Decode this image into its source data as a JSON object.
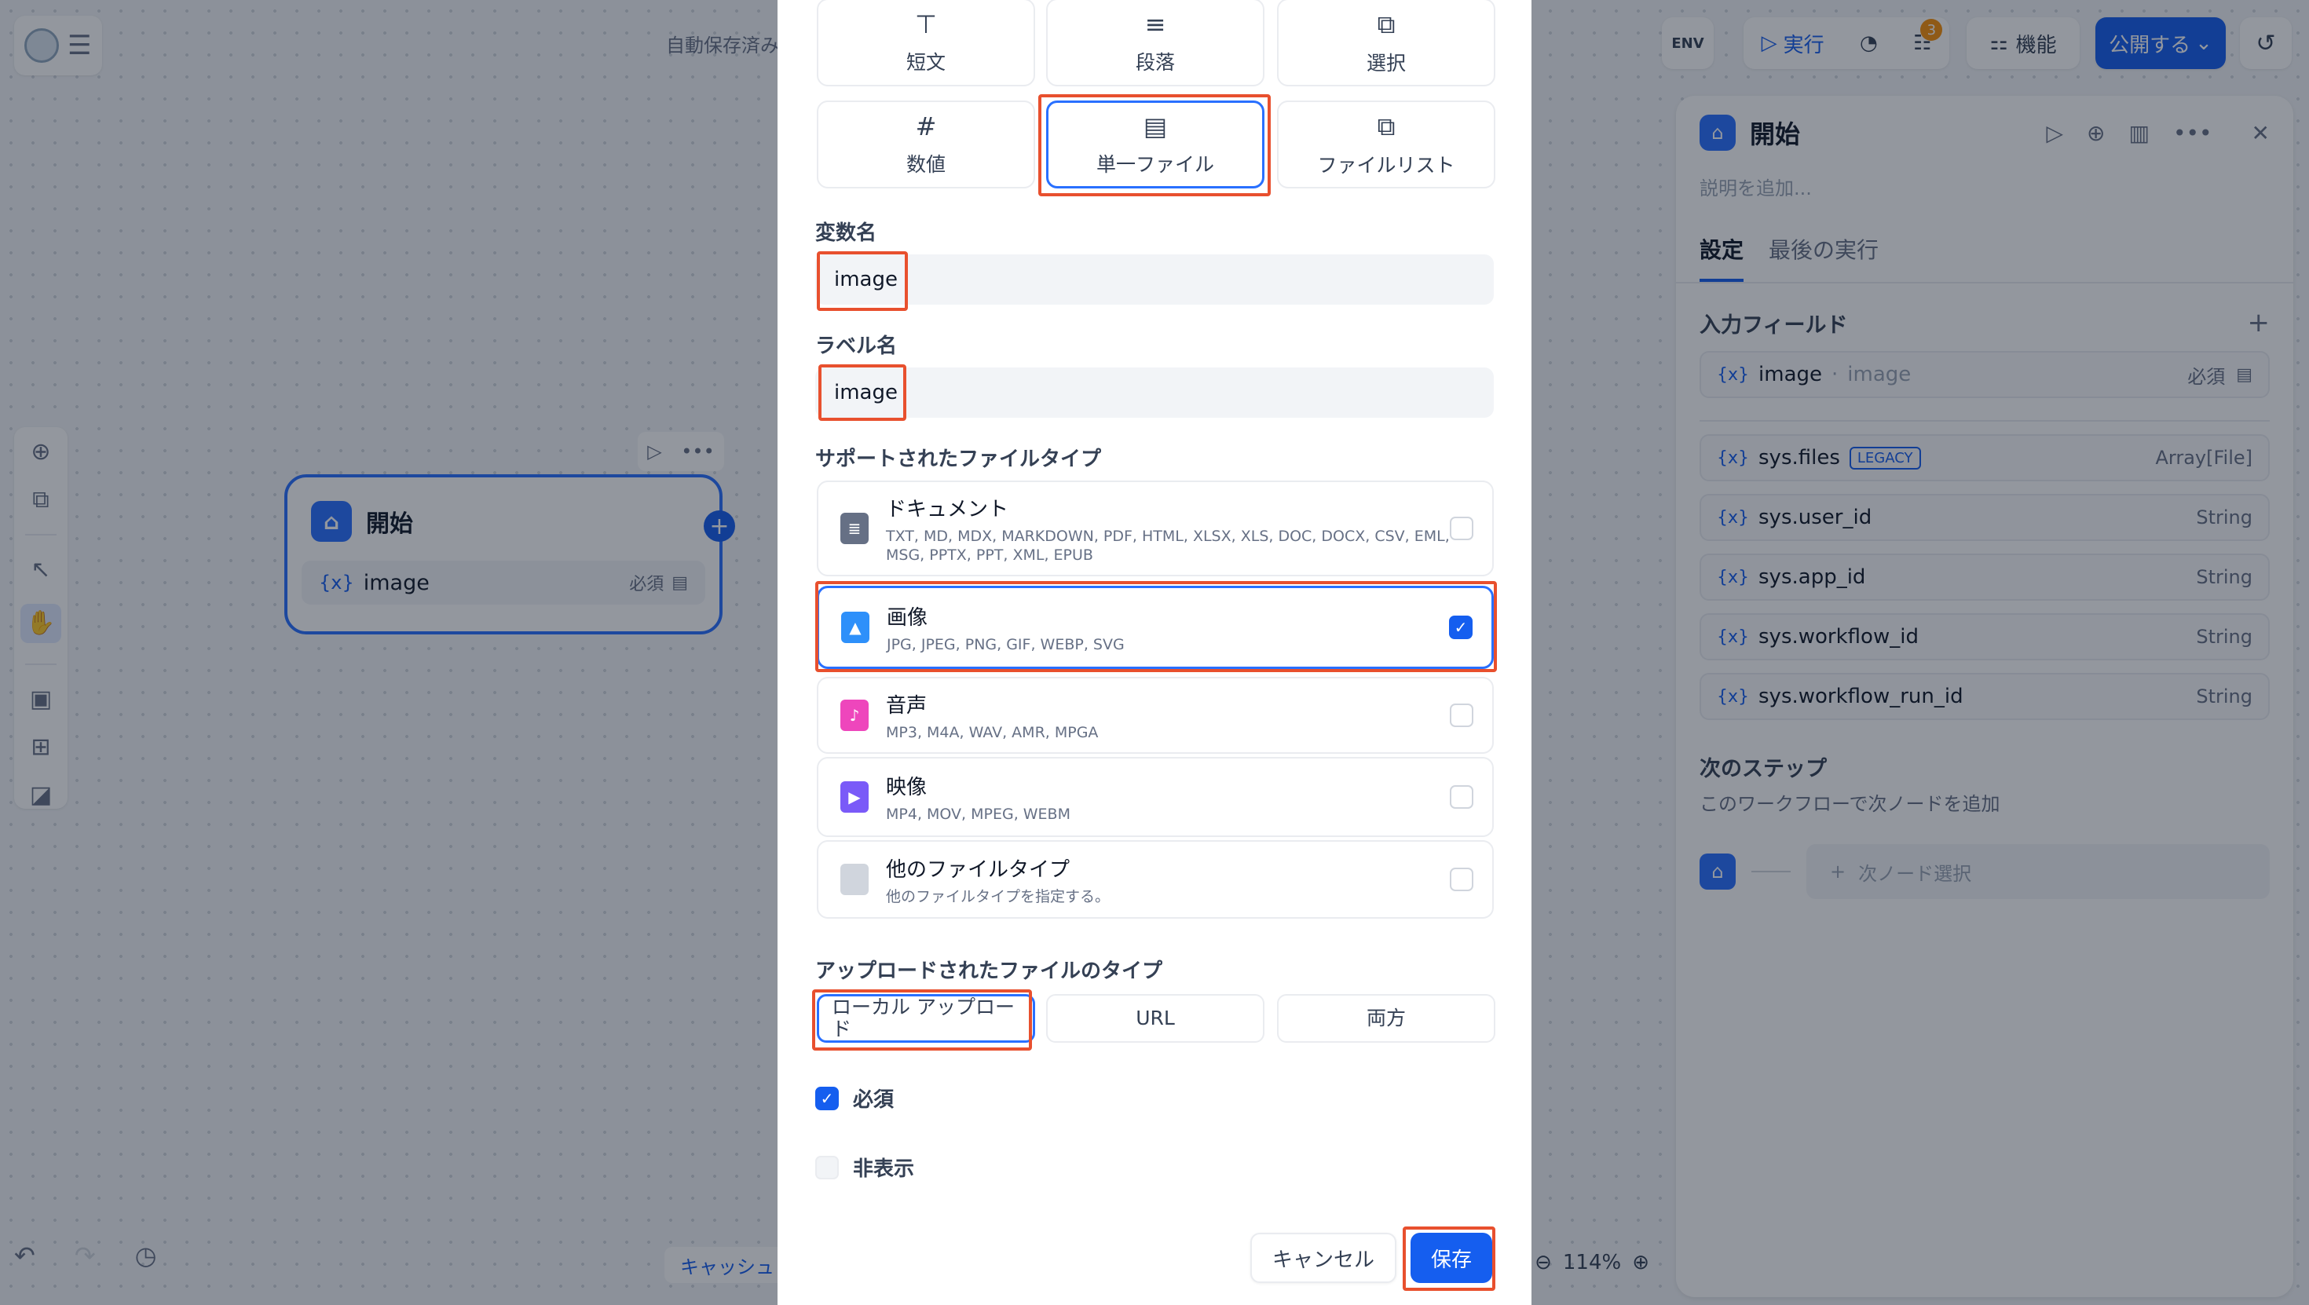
{
  "app": {
    "autosave_status": "自動保存済み",
    "env_label": "ENV",
    "run_label": "実行",
    "checklist_count": "3",
    "feature_label": "機能",
    "publish_label": "公開する",
    "zoom_level": "114%",
    "cancel_bg_label": "キャッシュ"
  },
  "canvas": {
    "start_node": {
      "title": "開始",
      "field_name": "image",
      "field_required": "必須"
    }
  },
  "right_panel": {
    "title": "開始",
    "description_placeholder": "説明を追加...",
    "tabs": [
      "設定",
      "最後の実行"
    ],
    "input_fields_title": "入力フィールド",
    "user_field": {
      "name": "image",
      "label": "image",
      "required": "必須"
    },
    "sys_fields": [
      {
        "name": "sys.files",
        "badge": "LEGACY",
        "type": "Array[File]"
      },
      {
        "name": "sys.user_id",
        "type": "String"
      },
      {
        "name": "sys.app_id",
        "type": "String"
      },
      {
        "name": "sys.workflow_id",
        "type": "String"
      },
      {
        "name": "sys.workflow_run_id",
        "type": "String"
      }
    ],
    "next_step_title": "次のステップ",
    "next_step_sub": "このワークフローで次ノードを追加",
    "next_select_label": "次ノード選択"
  },
  "modal": {
    "field_types": [
      {
        "label": "短文",
        "icon": "text-input-icon"
      },
      {
        "label": "段落",
        "icon": "paragraph-icon"
      },
      {
        "label": "選択",
        "icon": "select-icon"
      },
      {
        "label": "数値",
        "icon": "number-icon"
      },
      {
        "label": "単一ファイル",
        "icon": "file-icon"
      },
      {
        "label": "ファイルリスト",
        "icon": "file-list-icon"
      }
    ],
    "selected_type": "単一ファイル",
    "variable_name_label": "変数名",
    "variable_name_value": "image",
    "label_name_label": "ラベル名",
    "label_name_value": "image",
    "supported_types_title": "サポートされたファイルタイプ",
    "file_types": [
      {
        "name": "ドキュメント",
        "ext": "TXT, MD, MDX, MARKDOWN, PDF, HTML, XLSX, XLS, DOC, DOCX, CSV, EML, MSG, PPTX, PPT, XML, EPUB",
        "checked": false,
        "color": "#667085"
      },
      {
        "name": "画像",
        "ext": "JPG, JPEG, PNG, GIF, WEBP, SVG",
        "checked": true,
        "color": "#2e90fa"
      },
      {
        "name": "音声",
        "ext": "MP3, M4A, WAV, AMR, MPGA",
        "checked": false,
        "color": "#ee46bc"
      },
      {
        "name": "映像",
        "ext": "MP4, MOV, MPEG, WEBM",
        "checked": false,
        "color": "#7a5af8"
      },
      {
        "name": "他のファイルタイプ",
        "ext": "他のファイルタイプを指定する。",
        "checked": false,
        "color": "#d0d5dd"
      }
    ],
    "upload_types_title": "アップロードされたファイルのタイプ",
    "upload_methods": [
      "ローカル アップロード",
      "URL",
      "両方"
    ],
    "selected_upload": "ローカル アップロード",
    "required_label": "必須",
    "required_checked": true,
    "hidden_label": "非表示",
    "hidden_checked": false,
    "cancel_label": "キャンセル",
    "save_label": "保存"
  },
  "colors": {
    "accent": "#155eef",
    "highlight": "#e8502e"
  }
}
